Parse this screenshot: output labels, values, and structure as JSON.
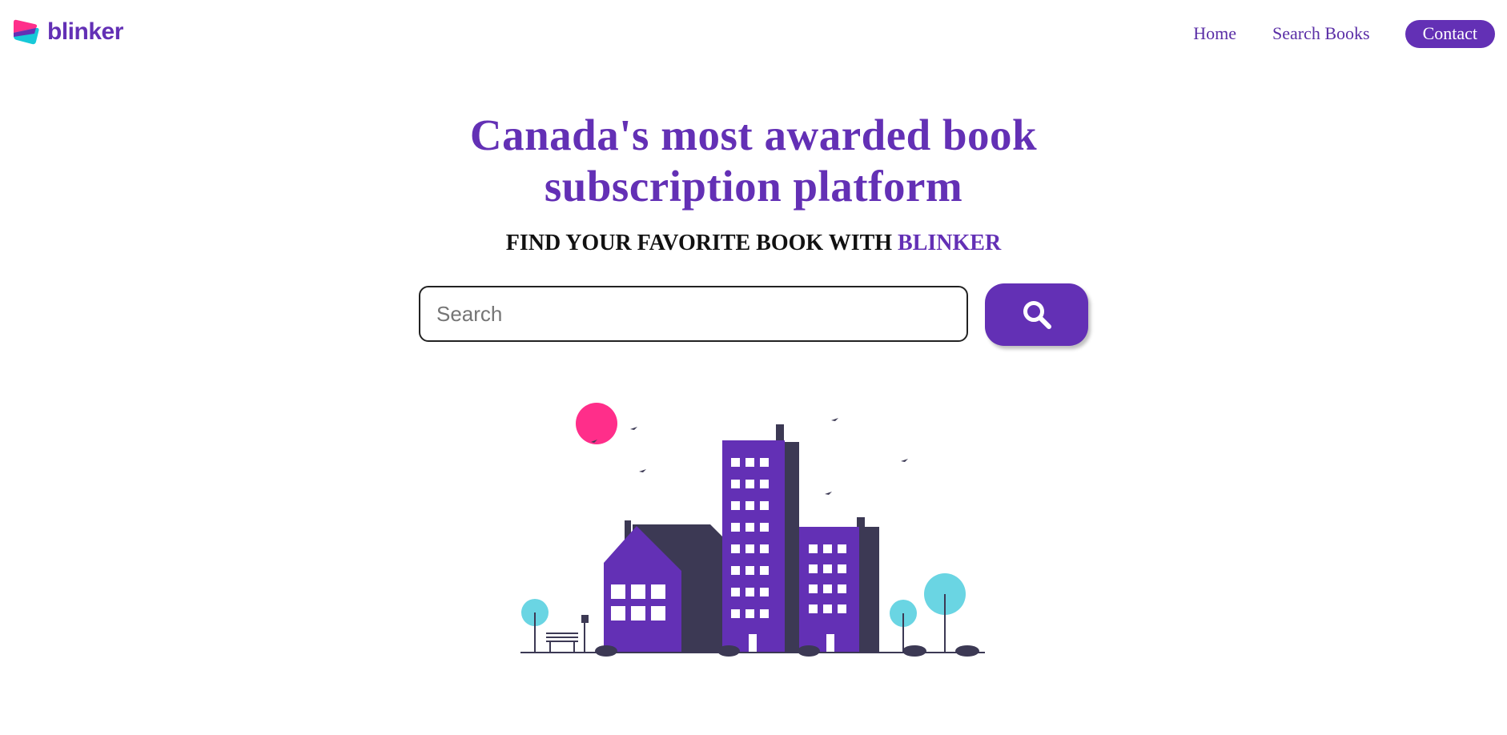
{
  "header": {
    "logo_text": "blinker",
    "nav": {
      "home": "Home",
      "search_books": "Search Books",
      "contact": "Contact"
    }
  },
  "hero": {
    "title_line1": "Canada's most awarded book",
    "title_line2": "subscription platform",
    "tagline_prefix": "FIND YOUR FAVORITE BOOK WITH ",
    "tagline_brand": "BLINKER"
  },
  "search": {
    "placeholder": "Search",
    "button_icon": "search-icon"
  },
  "colors": {
    "brand": "#6330b5",
    "accent_pink": "#ff2e8a",
    "accent_cyan": "#6ad5e3",
    "dark": "#3c3954"
  }
}
